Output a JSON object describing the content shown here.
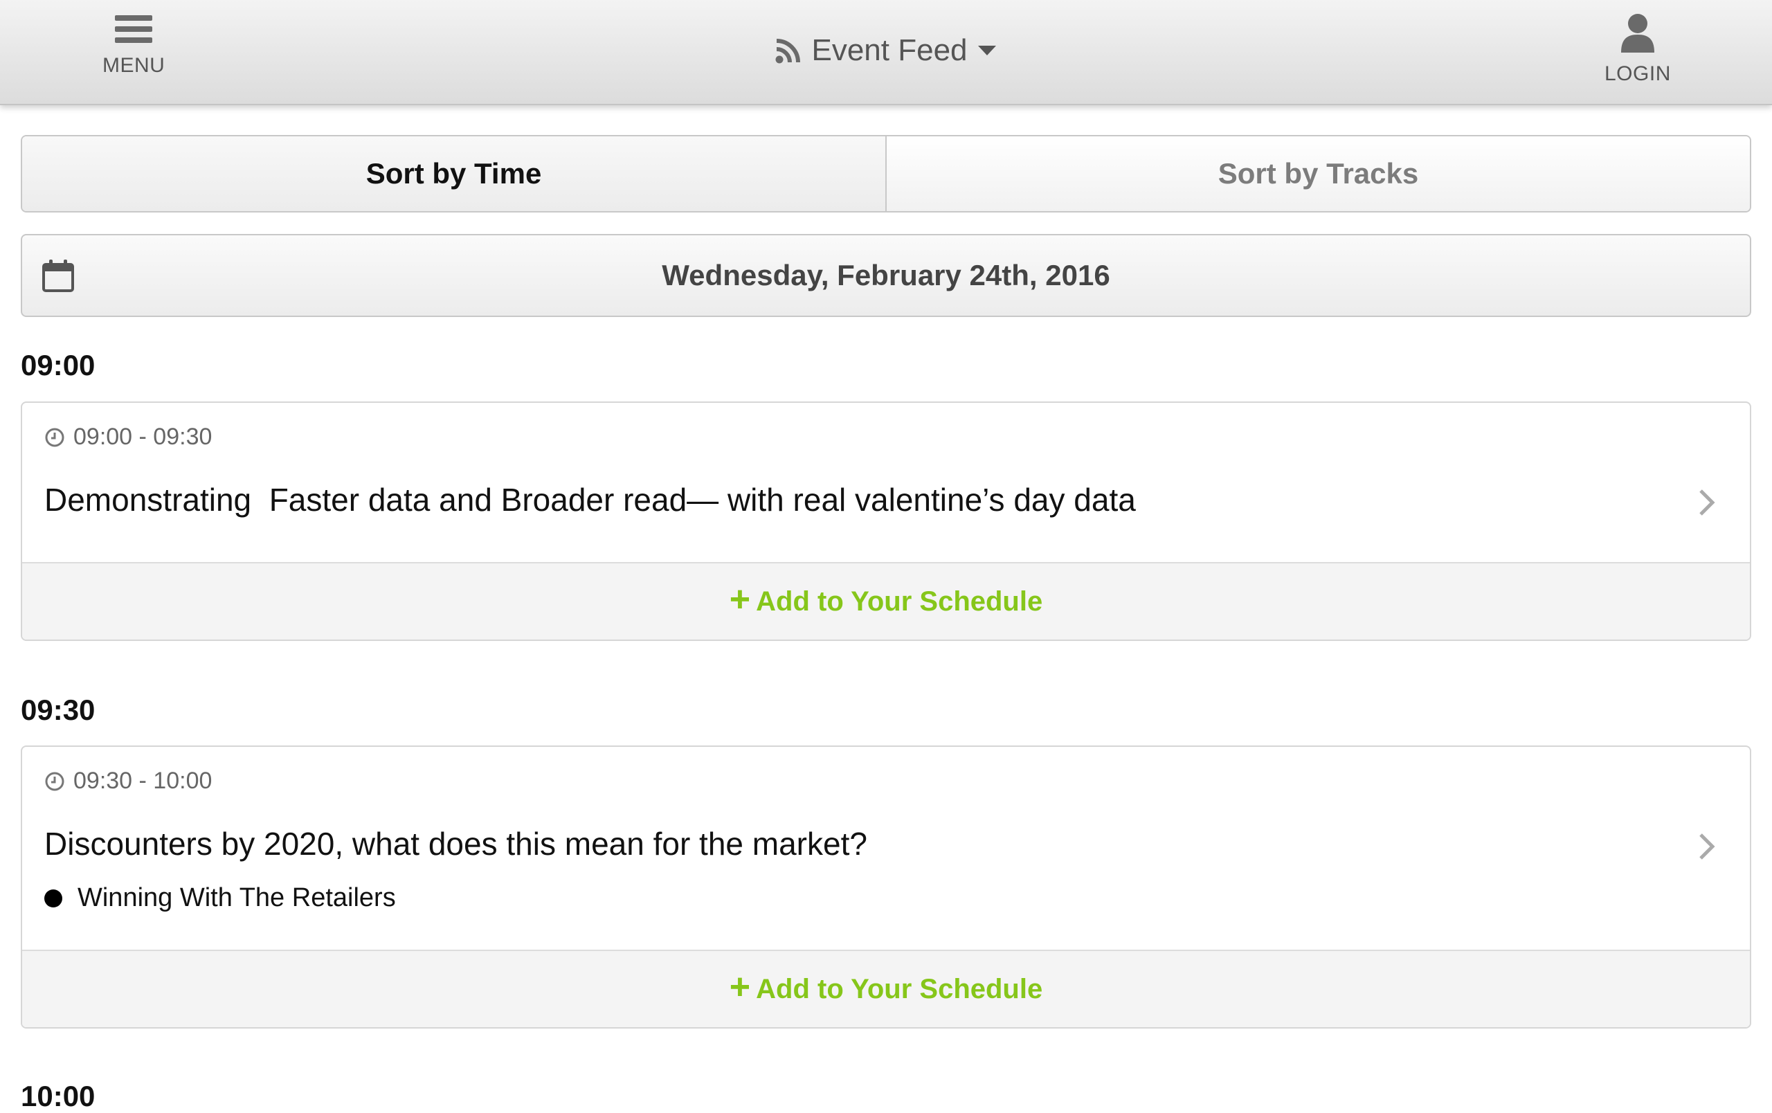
{
  "header": {
    "menu_label": "MENU",
    "title": "Event Feed",
    "login_label": "LOGIN"
  },
  "sort": {
    "by_time": "Sort by Time",
    "by_tracks": "Sort by Tracks",
    "active": "by_time"
  },
  "date": "Wednesday, February 24th, 2016",
  "slots": [
    {
      "heading": "09:00",
      "sessions": [
        {
          "time_range": "09:00 - 09:30",
          "title": "Demonstrating  Faster data and Broader read— with real valentine’s day data",
          "track": "",
          "add_label": "Add to Your Schedule"
        }
      ]
    },
    {
      "heading": "09:30",
      "sessions": [
        {
          "time_range": "09:30 - 10:00",
          "title": "Discounters by 2020, what does this mean for the market?",
          "track": "Winning With The Retailers",
          "add_label": "Add to Your Schedule"
        }
      ]
    },
    {
      "heading": "10:00",
      "sessions": []
    }
  ],
  "colors": {
    "accent_green": "#86c61a",
    "header_bg": "#e4e4e4",
    "muted_text": "#7c7c7c"
  },
  "icons": {
    "menu": "hamburger-icon",
    "feed": "rss-icon",
    "dropdown": "caret-down-icon",
    "login": "user-icon",
    "date": "calendar-icon",
    "time": "clock-icon",
    "open": "chevron-right-icon",
    "add": "plus-icon",
    "track": "bullet-dot-icon"
  }
}
